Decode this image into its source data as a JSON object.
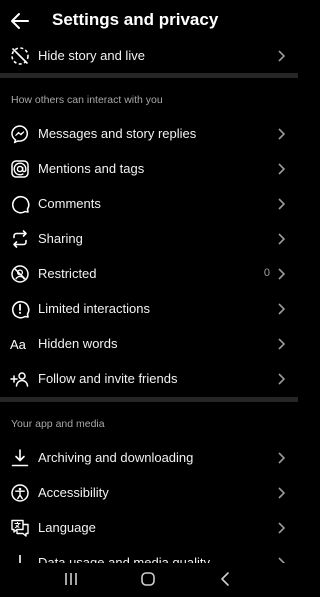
{
  "header": {
    "title": "Settings and privacy"
  },
  "top_items": [
    {
      "label": "Hide story and live",
      "icon": "hide-story-icon"
    }
  ],
  "sections": [
    {
      "title": "How others can interact with you",
      "items": [
        {
          "label": "Messages and story replies",
          "icon": "messenger-icon"
        },
        {
          "label": "Mentions and tags",
          "icon": "at-sign-icon"
        },
        {
          "label": "Comments",
          "icon": "comment-icon"
        },
        {
          "label": "Sharing",
          "icon": "share-icon"
        },
        {
          "label": "Restricted",
          "icon": "restricted-icon",
          "value": "0"
        },
        {
          "label": "Limited interactions",
          "icon": "alert-icon"
        },
        {
          "label": "Hidden words",
          "icon": "text-aa-icon",
          "glyph": "Aa"
        },
        {
          "label": "Follow and invite friends",
          "icon": "add-person-icon"
        }
      ]
    },
    {
      "title": "Your app and media",
      "items": [
        {
          "label": "Archiving and downloading",
          "icon": "download-icon"
        },
        {
          "label": "Accessibility",
          "icon": "accessibility-icon"
        },
        {
          "label": "Language",
          "icon": "language-icon"
        },
        {
          "label": "Data usage and media quality",
          "icon": "data-usage-icon"
        }
      ]
    }
  ],
  "system_nav": {
    "items": [
      "recent-apps-icon",
      "home-icon",
      "back-icon"
    ]
  }
}
